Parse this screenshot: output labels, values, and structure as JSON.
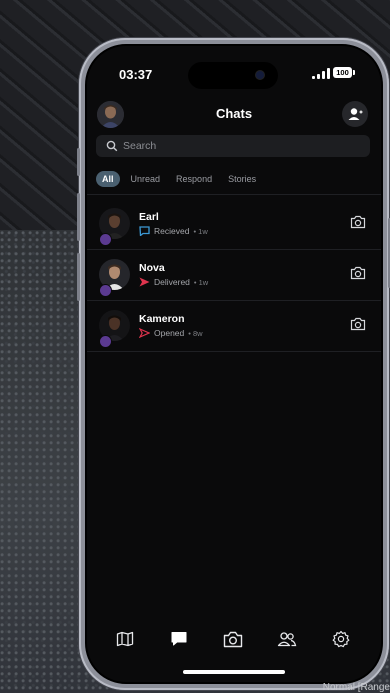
{
  "status_bar": {
    "time": "03:37",
    "battery": "100"
  },
  "header": {
    "title": "Chats"
  },
  "search": {
    "placeholder": "Search"
  },
  "filters": [
    "All",
    "Unread",
    "Respond",
    "Stories"
  ],
  "chats": [
    {
      "name": "Earl",
      "status": "Recieved",
      "ago": "• 1w",
      "status_icon": "chat-bubble-outline-icon",
      "status_color": "#3d9ad6"
    },
    {
      "name": "Nova",
      "status": "Delivered",
      "ago": "• 1w",
      "status_icon": "send-arrow-filled-icon",
      "status_color": "#e0344e"
    },
    {
      "name": "Kameron",
      "status": "Opened",
      "ago": "• 8w",
      "status_icon": "send-arrow-outline-icon",
      "status_color": "#e0344e"
    }
  ],
  "tabs": [
    "map-icon",
    "chat-icon",
    "camera-icon",
    "friends-icon",
    "settings-icon"
  ],
  "colors": {
    "accent_chip": "#4a6070",
    "screen_bg": "#0a0a0b",
    "badge": "#5b3a91"
  },
  "overlay": {
    "text": "Normal [Range"
  }
}
